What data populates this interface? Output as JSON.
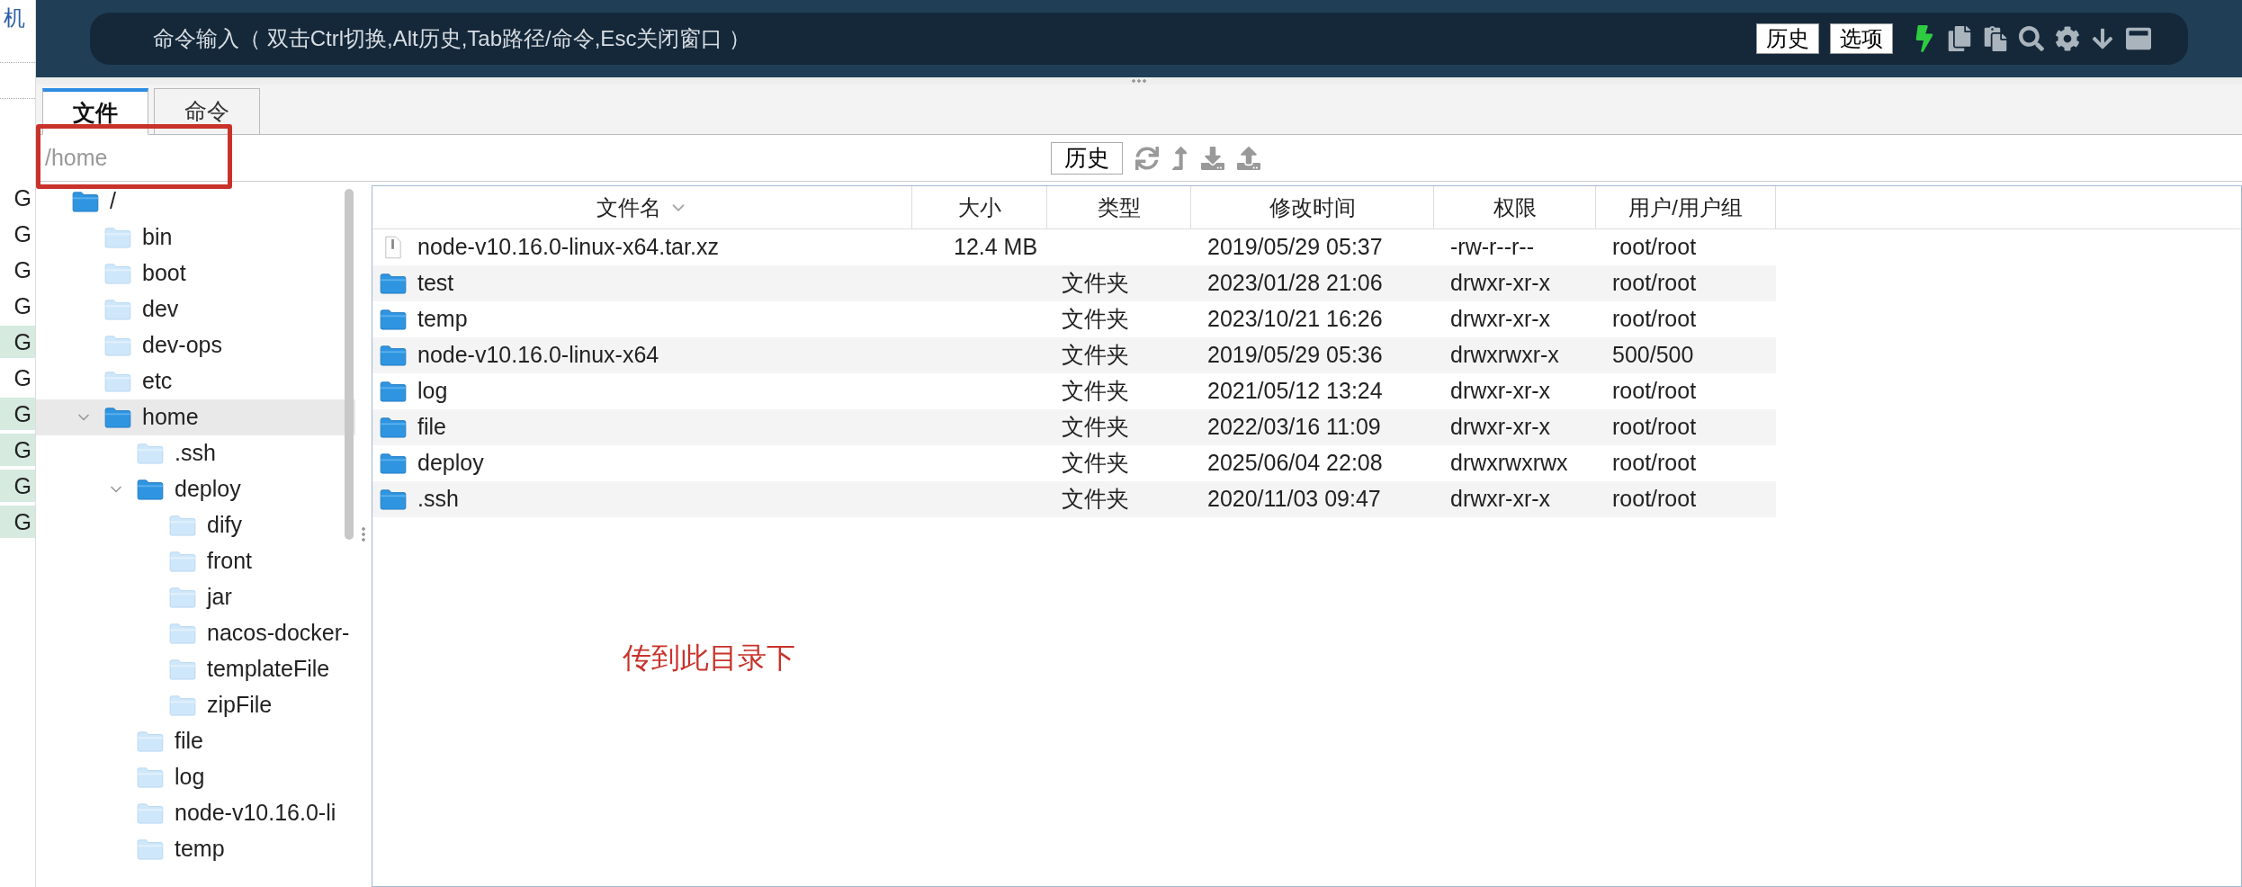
{
  "side_strip": {
    "title": "机",
    "items": [
      {
        "text": "G",
        "highlighted": false
      },
      {
        "text": "G",
        "highlighted": false
      },
      {
        "text": "G",
        "highlighted": false
      },
      {
        "text": "G",
        "highlighted": false
      },
      {
        "text": "G",
        "highlighted": true
      },
      {
        "text": "G",
        "highlighted": false
      },
      {
        "text": "G",
        "highlighted": true
      },
      {
        "text": "G",
        "highlighted": true
      },
      {
        "text": "G",
        "highlighted": true
      },
      {
        "text": "G",
        "highlighted": true
      }
    ]
  },
  "command_bar": {
    "placeholder": "命令输入（ 双击Ctrl切换,Alt历史,Tab路径/命令,Esc关闭窗口 ）",
    "buttons": [
      "历史",
      "选项"
    ]
  },
  "tabs": [
    {
      "label": "文件",
      "selected": true
    },
    {
      "label": "命令",
      "selected": false
    }
  ],
  "path_bar": {
    "value": "/home",
    "history_button": "历史"
  },
  "tree": [
    {
      "name": "/",
      "expanded": true,
      "selected": false,
      "children": [
        {
          "name": "bin",
          "expanded": false,
          "selected": false
        },
        {
          "name": "boot",
          "expanded": false,
          "selected": false
        },
        {
          "name": "dev",
          "expanded": false,
          "selected": false
        },
        {
          "name": "dev-ops",
          "expanded": false,
          "selected": false
        },
        {
          "name": "etc",
          "expanded": false,
          "selected": false
        },
        {
          "name": "home",
          "expanded": true,
          "selected": true,
          "children": [
            {
              "name": ".ssh",
              "expanded": false,
              "selected": false
            },
            {
              "name": "deploy",
              "expanded": true,
              "selected": false,
              "children": [
                {
                  "name": "dify",
                  "expanded": false,
                  "selected": false
                },
                {
                  "name": "front",
                  "expanded": false,
                  "selected": false
                },
                {
                  "name": "jar",
                  "expanded": false,
                  "selected": false
                },
                {
                  "name": "nacos-docker-",
                  "expanded": false,
                  "selected": false
                },
                {
                  "name": "templateFile",
                  "expanded": false,
                  "selected": false
                },
                {
                  "name": "zipFile",
                  "expanded": false,
                  "selected": false
                }
              ]
            },
            {
              "name": "file",
              "expanded": false,
              "selected": false
            },
            {
              "name": "log",
              "expanded": false,
              "selected": false
            },
            {
              "name": "node-v10.16.0-li",
              "expanded": false,
              "selected": false
            },
            {
              "name": "temp",
              "expanded": false,
              "selected": false
            }
          ]
        }
      ]
    }
  ],
  "table": {
    "columns": [
      {
        "label": "文件名",
        "sorted": true
      },
      {
        "label": "大小",
        "sorted": false
      },
      {
        "label": "类型",
        "sorted": false
      },
      {
        "label": "修改时间",
        "sorted": false
      },
      {
        "label": "权限",
        "sorted": false
      },
      {
        "label": "用户/用户组",
        "sorted": false
      }
    ],
    "rows": [
      {
        "kind": "file",
        "name": "node-v10.16.0-linux-x64.tar.xz",
        "size": "12.4 MB",
        "modified": "2019/05/29 05:37",
        "permissions": "-rw-r--r--",
        "owner": "root/root"
      },
      {
        "kind": "folder",
        "name": "test",
        "type": "文件夹",
        "modified": "2023/01/28 21:06",
        "permissions": "drwxr-xr-x",
        "owner": "root/root"
      },
      {
        "kind": "folder",
        "name": "temp",
        "type": "文件夹",
        "modified": "2023/10/21 16:26",
        "permissions": "drwxr-xr-x",
        "owner": "root/root"
      },
      {
        "kind": "folder",
        "name": "node-v10.16.0-linux-x64",
        "type": "文件夹",
        "modified": "2019/05/29 05:36",
        "permissions": "drwxrwxr-x",
        "owner": "500/500"
      },
      {
        "kind": "folder",
        "name": "log",
        "type": "文件夹",
        "modified": "2021/05/12 13:24",
        "permissions": "drwxr-xr-x",
        "owner": "root/root"
      },
      {
        "kind": "folder",
        "name": "file",
        "type": "文件夹",
        "modified": "2022/03/16 11:09",
        "permissions": "drwxr-xr-x",
        "owner": "root/root"
      },
      {
        "kind": "folder",
        "name": "deploy",
        "type": "文件夹",
        "modified": "2025/06/04 22:08",
        "permissions": "drwxrwxrwx",
        "owner": "root/root"
      },
      {
        "kind": "folder",
        "name": ".ssh",
        "type": "文件夹",
        "modified": "2020/11/03 09:47",
        "permissions": "drwxr-xr-x",
        "owner": "root/root"
      }
    ]
  },
  "annotation": {
    "text": "传到此目录下"
  }
}
